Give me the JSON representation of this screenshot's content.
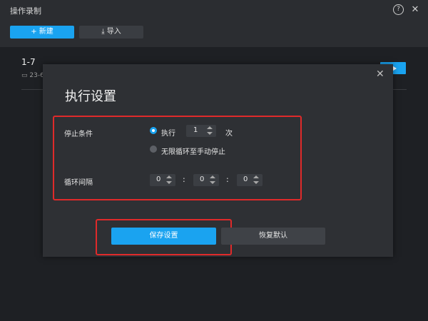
{
  "window": {
    "title": "操作录制",
    "help_icon": "help-icon",
    "close_icon": "close-icon"
  },
  "toolbar": {
    "new_label": "+ 新建",
    "import_label": "⤓ 导入"
  },
  "records": [
    {
      "name": "1-7",
      "date": "▭ 23-6"
    }
  ],
  "dialog": {
    "title": "执行设置",
    "close_label": "✕",
    "stop_condition": {
      "label": "停止条件",
      "exec_label": "执行",
      "count_value": "1",
      "unit_label": "次",
      "loop_label": "无限循环至手动停止",
      "selected": "exec"
    },
    "interval": {
      "label": "循环间隔",
      "hours": "0",
      "minutes": "0",
      "seconds": "0",
      "separator": ":"
    },
    "save_label": "保存设置",
    "reset_label": "恢复默认"
  },
  "colors": {
    "accent": "#1aa3f0",
    "highlight": "#e02a2a",
    "dialog_bg": "#2e3034",
    "page_bg": "#1e2024"
  }
}
